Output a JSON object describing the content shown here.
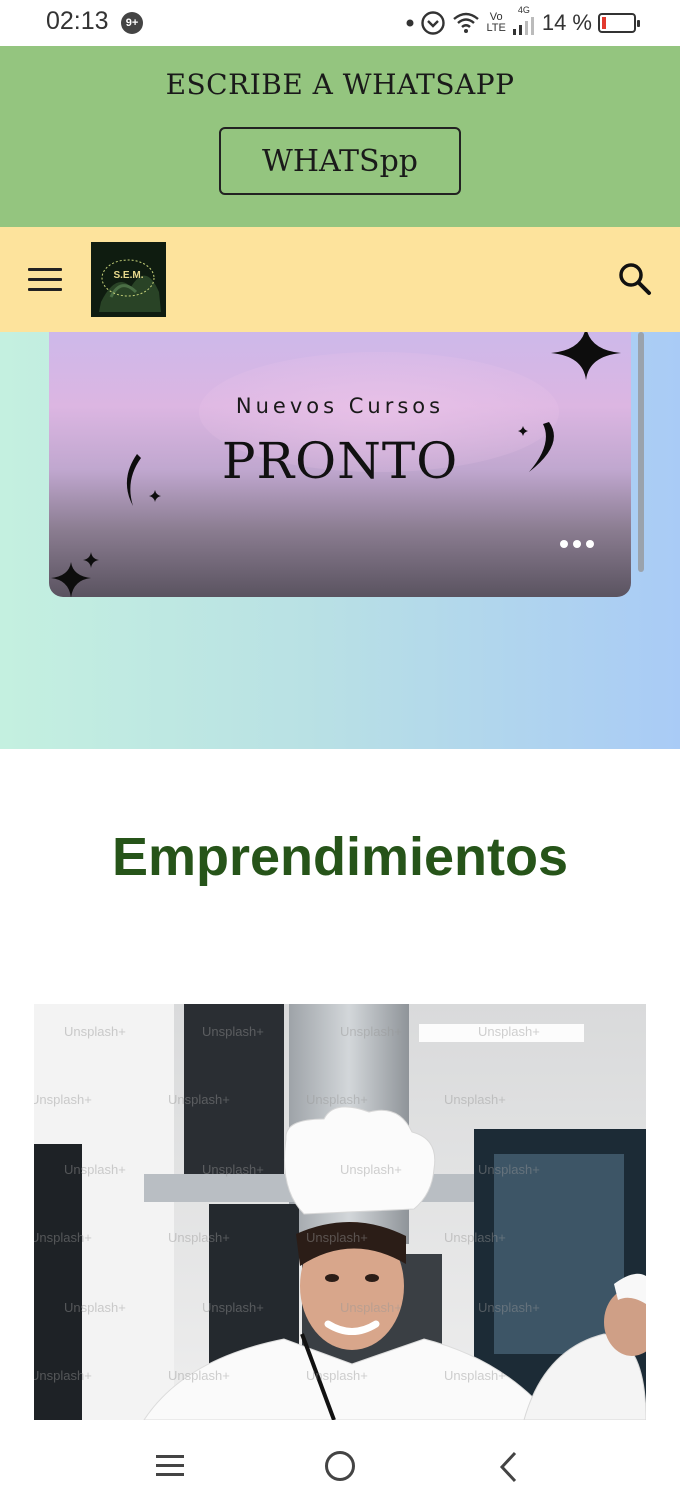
{
  "status_bar": {
    "time": "02:13",
    "notification_badge": "9+",
    "volte_top": "Vo",
    "volte_bottom": "LTE",
    "network": "4G",
    "battery_text": "14 %",
    "battery_level": 0.14
  },
  "whatsapp_banner": {
    "title": "ESCRIBE A WHATSAPP",
    "button_label": "WHATSpp",
    "background": "#94c57f"
  },
  "navbar": {
    "logo_text": "S.E.M.",
    "menu_icon": "hamburger-menu-icon",
    "search_icon": "search-icon",
    "background": "#fde39c"
  },
  "promo": {
    "subtitle": "Nuevos Cursos",
    "title": "PRONTO",
    "more_icon": "more-horizontal-icon"
  },
  "section": {
    "title": "Emprendimientos",
    "title_color": "#265419"
  },
  "photo": {
    "watermark": "Unsplash+",
    "subject": "chef"
  },
  "system_nav": {
    "recents": "recents-icon",
    "home": "home-icon",
    "back": "back-icon"
  }
}
